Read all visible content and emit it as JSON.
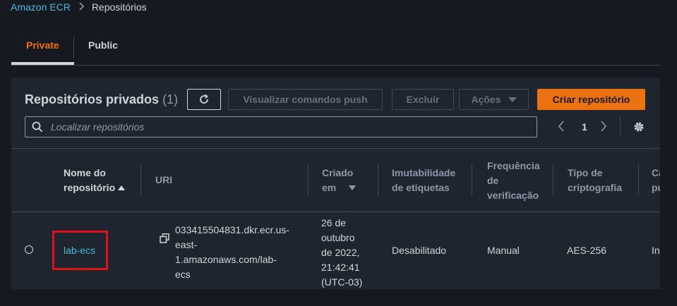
{
  "breadcrumb": {
    "root": "Amazon ECR",
    "current": "Repositórios"
  },
  "tabs": {
    "private": "Private",
    "public": "Public"
  },
  "panel": {
    "title": "Repositórios privados",
    "count": "(1)",
    "buttons": {
      "push": "Visualizar comandos push",
      "delete": "Excluir",
      "actions": "Ações",
      "create": "Criar repositório"
    },
    "search_placeholder": "Localizar repositórios",
    "page": "1"
  },
  "table": {
    "headers": {
      "name_1": "Nome do",
      "name_2": "repositório",
      "uri": "URI",
      "created_1": "Criado",
      "created_2": "em",
      "immut_1": "Imutabilidade",
      "immut_2": "de etiquetas",
      "freq_1": "Frequência",
      "freq_2": "de",
      "freq_3": "verificação",
      "crypto_1": "Tipo de",
      "crypto_2": "criptografia",
      "cut_1": "Ca",
      "cut_2": "pu"
    },
    "rows": [
      {
        "name": "lab-ecs",
        "uri_lines": [
          "033415504831.dkr.ecr.us-",
          "east-",
          "1.amazonaws.com/lab-",
          "ecs"
        ],
        "created_lines": [
          "26 de",
          "outubro",
          "de 2022,",
          "21:42:41",
          "(UTC-03)"
        ],
        "immutability": "Desabilitado",
        "frequency": "Manual",
        "encryption": "AES-256",
        "cut": "In"
      }
    ]
  },
  "colors": {
    "accent": "#ec7211",
    "link": "#44b9d6",
    "highlight": "#e0101a",
    "background": "#16191f"
  }
}
